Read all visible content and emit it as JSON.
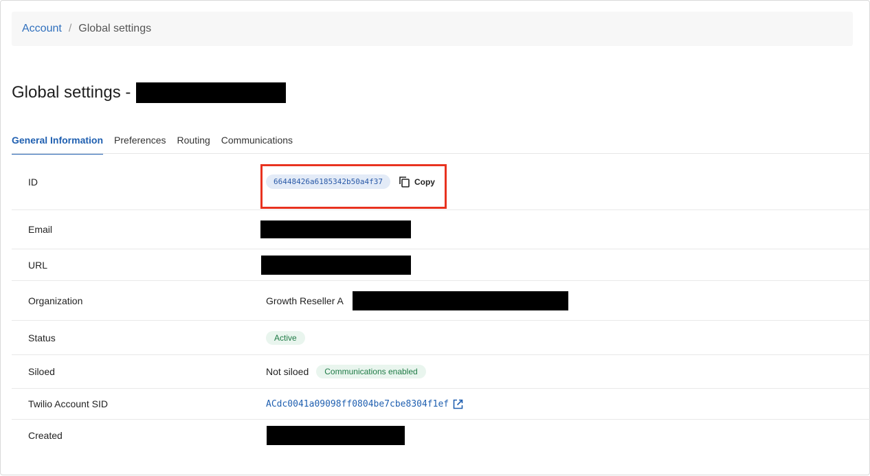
{
  "breadcrumb": {
    "parent": "Account",
    "separator": "/",
    "current": "Global settings"
  },
  "page": {
    "title_prefix": "Global settings -"
  },
  "tabs": [
    {
      "label": "General Information",
      "active": true
    },
    {
      "label": "Preferences",
      "active": false
    },
    {
      "label": "Routing",
      "active": false
    },
    {
      "label": "Communications",
      "active": false
    }
  ],
  "fields": {
    "id": {
      "label": "ID",
      "value": "66448426a6185342b50a4f37",
      "copy_label": "Copy"
    },
    "email": {
      "label": "Email"
    },
    "url": {
      "label": "URL"
    },
    "organization": {
      "label": "Organization",
      "value": "Growth Reseller A"
    },
    "status": {
      "label": "Status",
      "badge": "Active"
    },
    "siloed": {
      "label": "Siloed",
      "value": "Not siloed",
      "badge": "Communications enabled"
    },
    "twilio": {
      "label": "Twilio Account SID",
      "value": "ACdc0041a09098ff0804be7cbe8304f1ef"
    },
    "created": {
      "label": "Created"
    }
  },
  "colors": {
    "accent": "#1f5fb0",
    "highlight_border": "#e8321f",
    "badge_green_text": "#1e7a45",
    "badge_green_bg": "#e9f5ee"
  },
  "icons": {
    "copy": "copy-icon",
    "external_link": "external-link-icon"
  }
}
